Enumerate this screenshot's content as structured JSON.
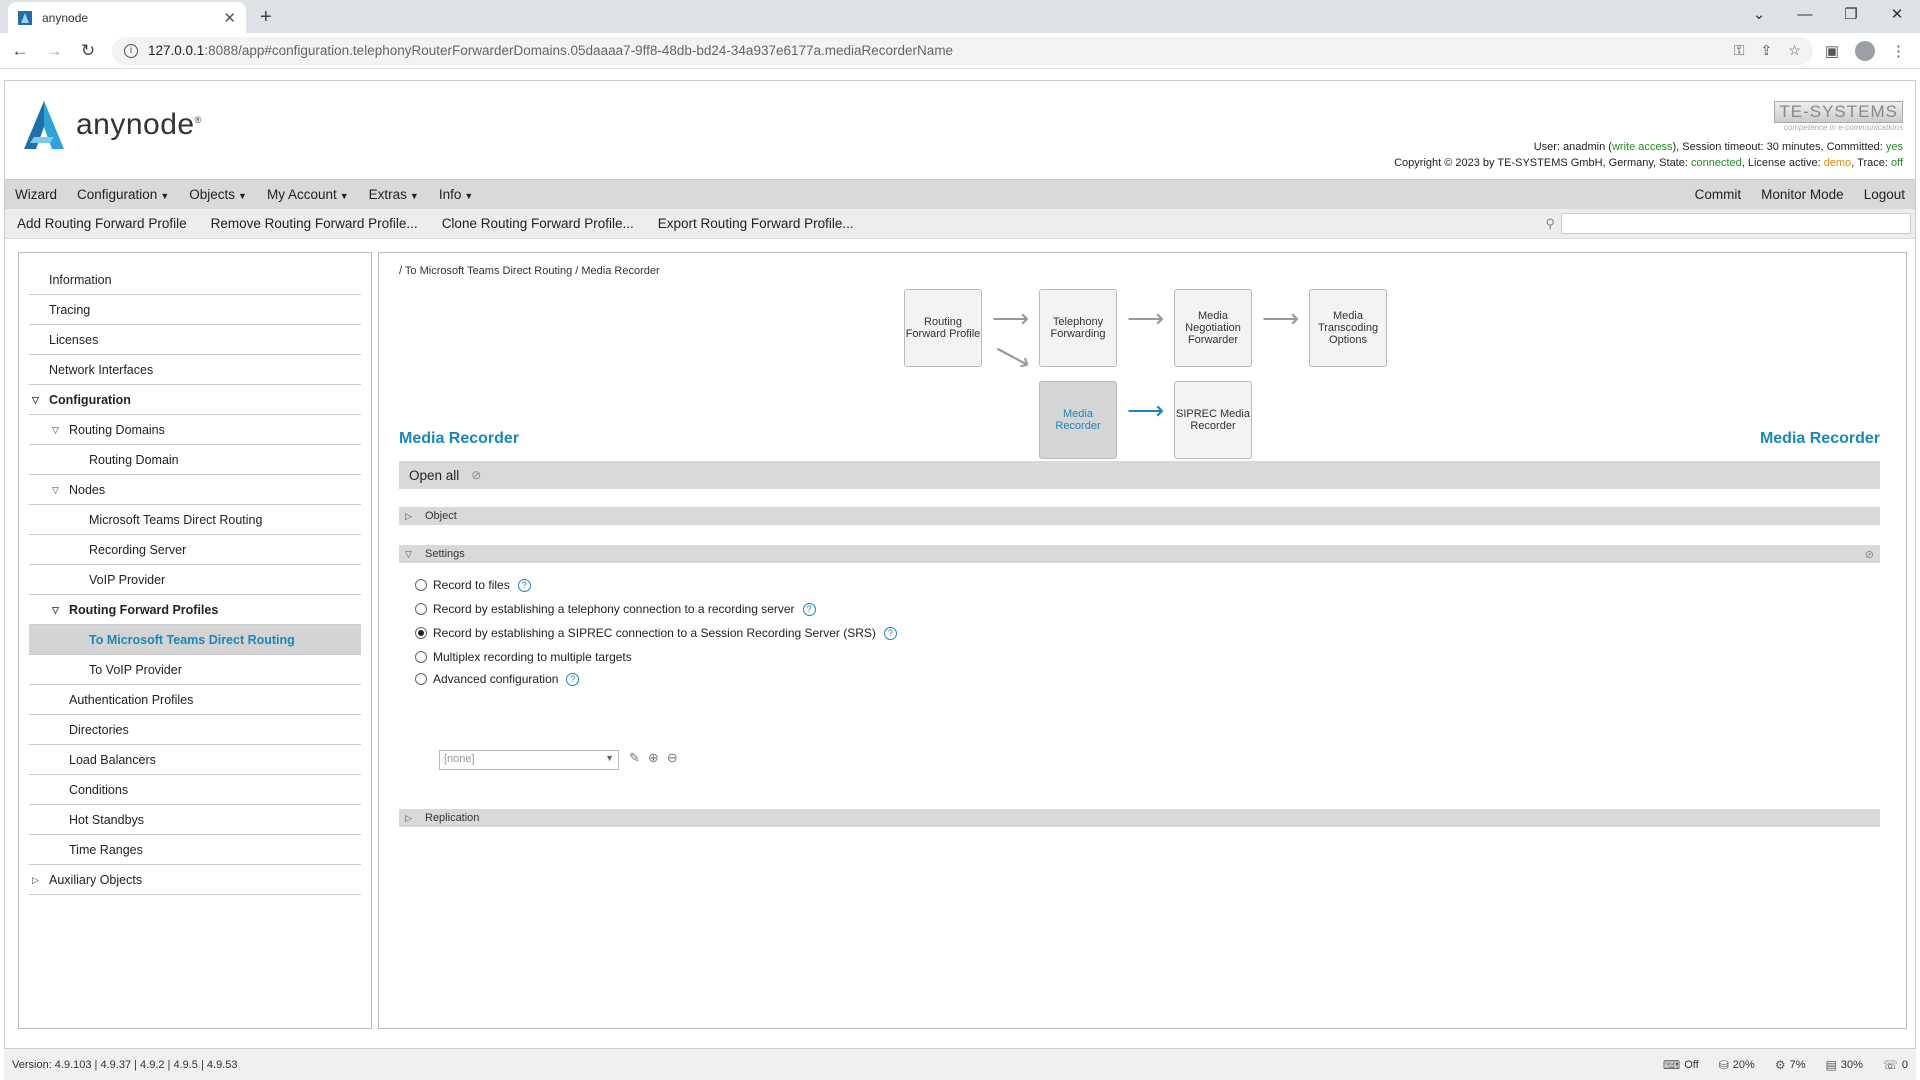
{
  "browser": {
    "tab_title": "anynode",
    "url_host": "127.0.0.1",
    "url_rest": ":8088/app#configuration.telephonyRouterForwarderDomains.05daaaa7-9ff8-48db-bd24-34a937e6177a.mediaRecorderName"
  },
  "header": {
    "logo_text": "anynode",
    "brand": "TE-SYSTEMS",
    "brand_tagline": "competence in e-communications",
    "user_prefix": "User: anadmin (",
    "user_access": "write access",
    "user_mid": "), Session timeout: 30 minutes, Committed: ",
    "committed": "yes",
    "copyright_prefix": "Copyright © 2023 by TE-SYSTEMS GmbH, Germany, State: ",
    "state": "connected",
    "license_prefix": ", License active: ",
    "license": "demo",
    "trace_prefix": ", Trace: ",
    "trace": "off"
  },
  "menubar": {
    "wizard": "Wizard",
    "configuration": "Configuration",
    "objects": "Objects",
    "my_account": "My Account",
    "extras": "Extras",
    "info": "Info",
    "commit": "Commit",
    "monitor_mode": "Monitor Mode",
    "logout": "Logout"
  },
  "actionbar": {
    "add": "Add Routing Forward Profile",
    "remove": "Remove Routing Forward Profile...",
    "clone": "Clone Routing Forward Profile...",
    "export": "Export Routing Forward Profile..."
  },
  "sidebar": {
    "items": [
      {
        "label": "Information"
      },
      {
        "label": "Tracing"
      },
      {
        "label": "Licenses"
      },
      {
        "label": "Network Interfaces"
      },
      {
        "label": "Configuration"
      },
      {
        "label": "Routing Domains"
      },
      {
        "label": "Routing Domain"
      },
      {
        "label": "Nodes"
      },
      {
        "label": "Microsoft Teams Direct Routing"
      },
      {
        "label": "Recording Server"
      },
      {
        "label": "VoIP Provider"
      },
      {
        "label": "Routing Forward Profiles"
      },
      {
        "label": "To Microsoft Teams Direct Routing"
      },
      {
        "label": "To VoIP Provider"
      },
      {
        "label": "Authentication Profiles"
      },
      {
        "label": "Directories"
      },
      {
        "label": "Load Balancers"
      },
      {
        "label": "Conditions"
      },
      {
        "label": "Hot Standbys"
      },
      {
        "label": "Time Ranges"
      },
      {
        "label": "Auxiliary Objects"
      }
    ]
  },
  "main": {
    "breadcrumb": "/ To Microsoft Teams Direct Routing / Media Recorder",
    "flow": {
      "routing_forward_profile": "Routing Forward Profile",
      "telephony_forwarding": "Telephony Forwarding",
      "media_negotiation_forwarder": "Media Negotiation Forwarder",
      "media_transcoding_options": "Media Transcoding Options",
      "media_recorder": "Media Recorder",
      "siprec_media_recorder": "SIPREC Media Recorder"
    },
    "title_left": "Media Recorder",
    "title_right": "Media Recorder",
    "open_all": "Open all",
    "panels": {
      "object": "Object",
      "settings": "Settings",
      "replication": "Replication"
    },
    "options": [
      {
        "label": "Record to files",
        "selected": false,
        "help": true
      },
      {
        "label": "Record by establishing a telephony connection to a recording server",
        "selected": false,
        "help": true
      },
      {
        "label": "Record by establishing a SIPREC connection to a Session Recording Server (SRS)",
        "selected": true,
        "help": true
      },
      {
        "label": "Multiplex recording to multiple targets",
        "selected": false,
        "help": false
      },
      {
        "label": "Advanced configuration",
        "selected": false,
        "help": true
      }
    ],
    "select_value": "[none]"
  },
  "statusbar": {
    "version": "Version: 4.9.103 | 4.9.37 | 4.9.2 | 4.9.5 | 4.9.53",
    "s1": "Off",
    "s2": "20%",
    "s3": "7%",
    "s4": "30%",
    "s5": "0"
  }
}
